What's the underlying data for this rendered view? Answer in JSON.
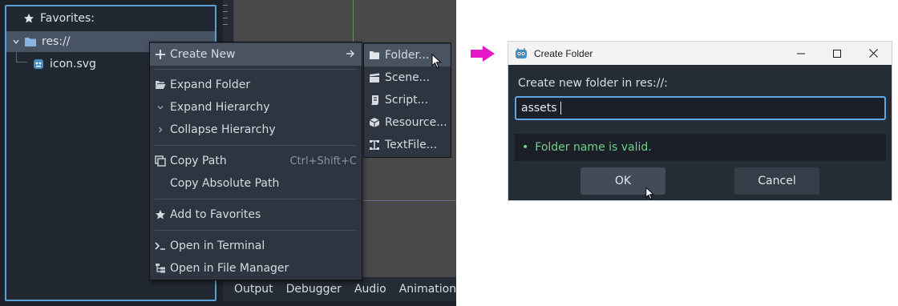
{
  "filesystem": {
    "favorites_label": "Favorites:",
    "root_label": "res://",
    "file_label": "icon.svg"
  },
  "context_menu": {
    "items": [
      {
        "label": "Create New",
        "icon": "plus-icon",
        "submenu": true
      },
      {
        "label": "Expand Folder",
        "icon": "folder-open-icon"
      },
      {
        "label": "Expand Hierarchy",
        "icon": "chevron-down-icon"
      },
      {
        "label": "Collapse Hierarchy",
        "icon": "chevron-right-icon"
      },
      {
        "label": "Copy Path",
        "icon": "copy-icon",
        "shortcut": "Ctrl+Shift+C"
      },
      {
        "label": "Copy Absolute Path"
      },
      {
        "label": "Add to Favorites",
        "icon": "star-icon"
      },
      {
        "label": "Open in Terminal",
        "icon": "terminal-icon"
      },
      {
        "label": "Open in File Manager",
        "icon": "file-tree-icon"
      }
    ]
  },
  "submenu": {
    "items": [
      {
        "label": "Folder...",
        "icon": "folder-icon"
      },
      {
        "label": "Scene...",
        "icon": "clapperboard-icon"
      },
      {
        "label": "Script...",
        "icon": "script-icon"
      },
      {
        "label": "Resource...",
        "icon": "cube-icon"
      },
      {
        "label": "TextFile...",
        "icon": "text-file-icon"
      }
    ]
  },
  "bottom_panel": {
    "tabs": [
      "Output",
      "Debugger",
      "Audio",
      "Animation"
    ]
  },
  "dialog": {
    "title": "Create Folder",
    "prompt": "Create new folder in res://:",
    "input_value": "assets",
    "status": "Folder name is valid.",
    "ok_label": "OK",
    "cancel_label": "Cancel"
  },
  "colors": {
    "accent": "#5fa8e6",
    "status_valid": "#71d18a",
    "step_arrow": "#e619c8",
    "output_dot": "#f2cc3a"
  }
}
